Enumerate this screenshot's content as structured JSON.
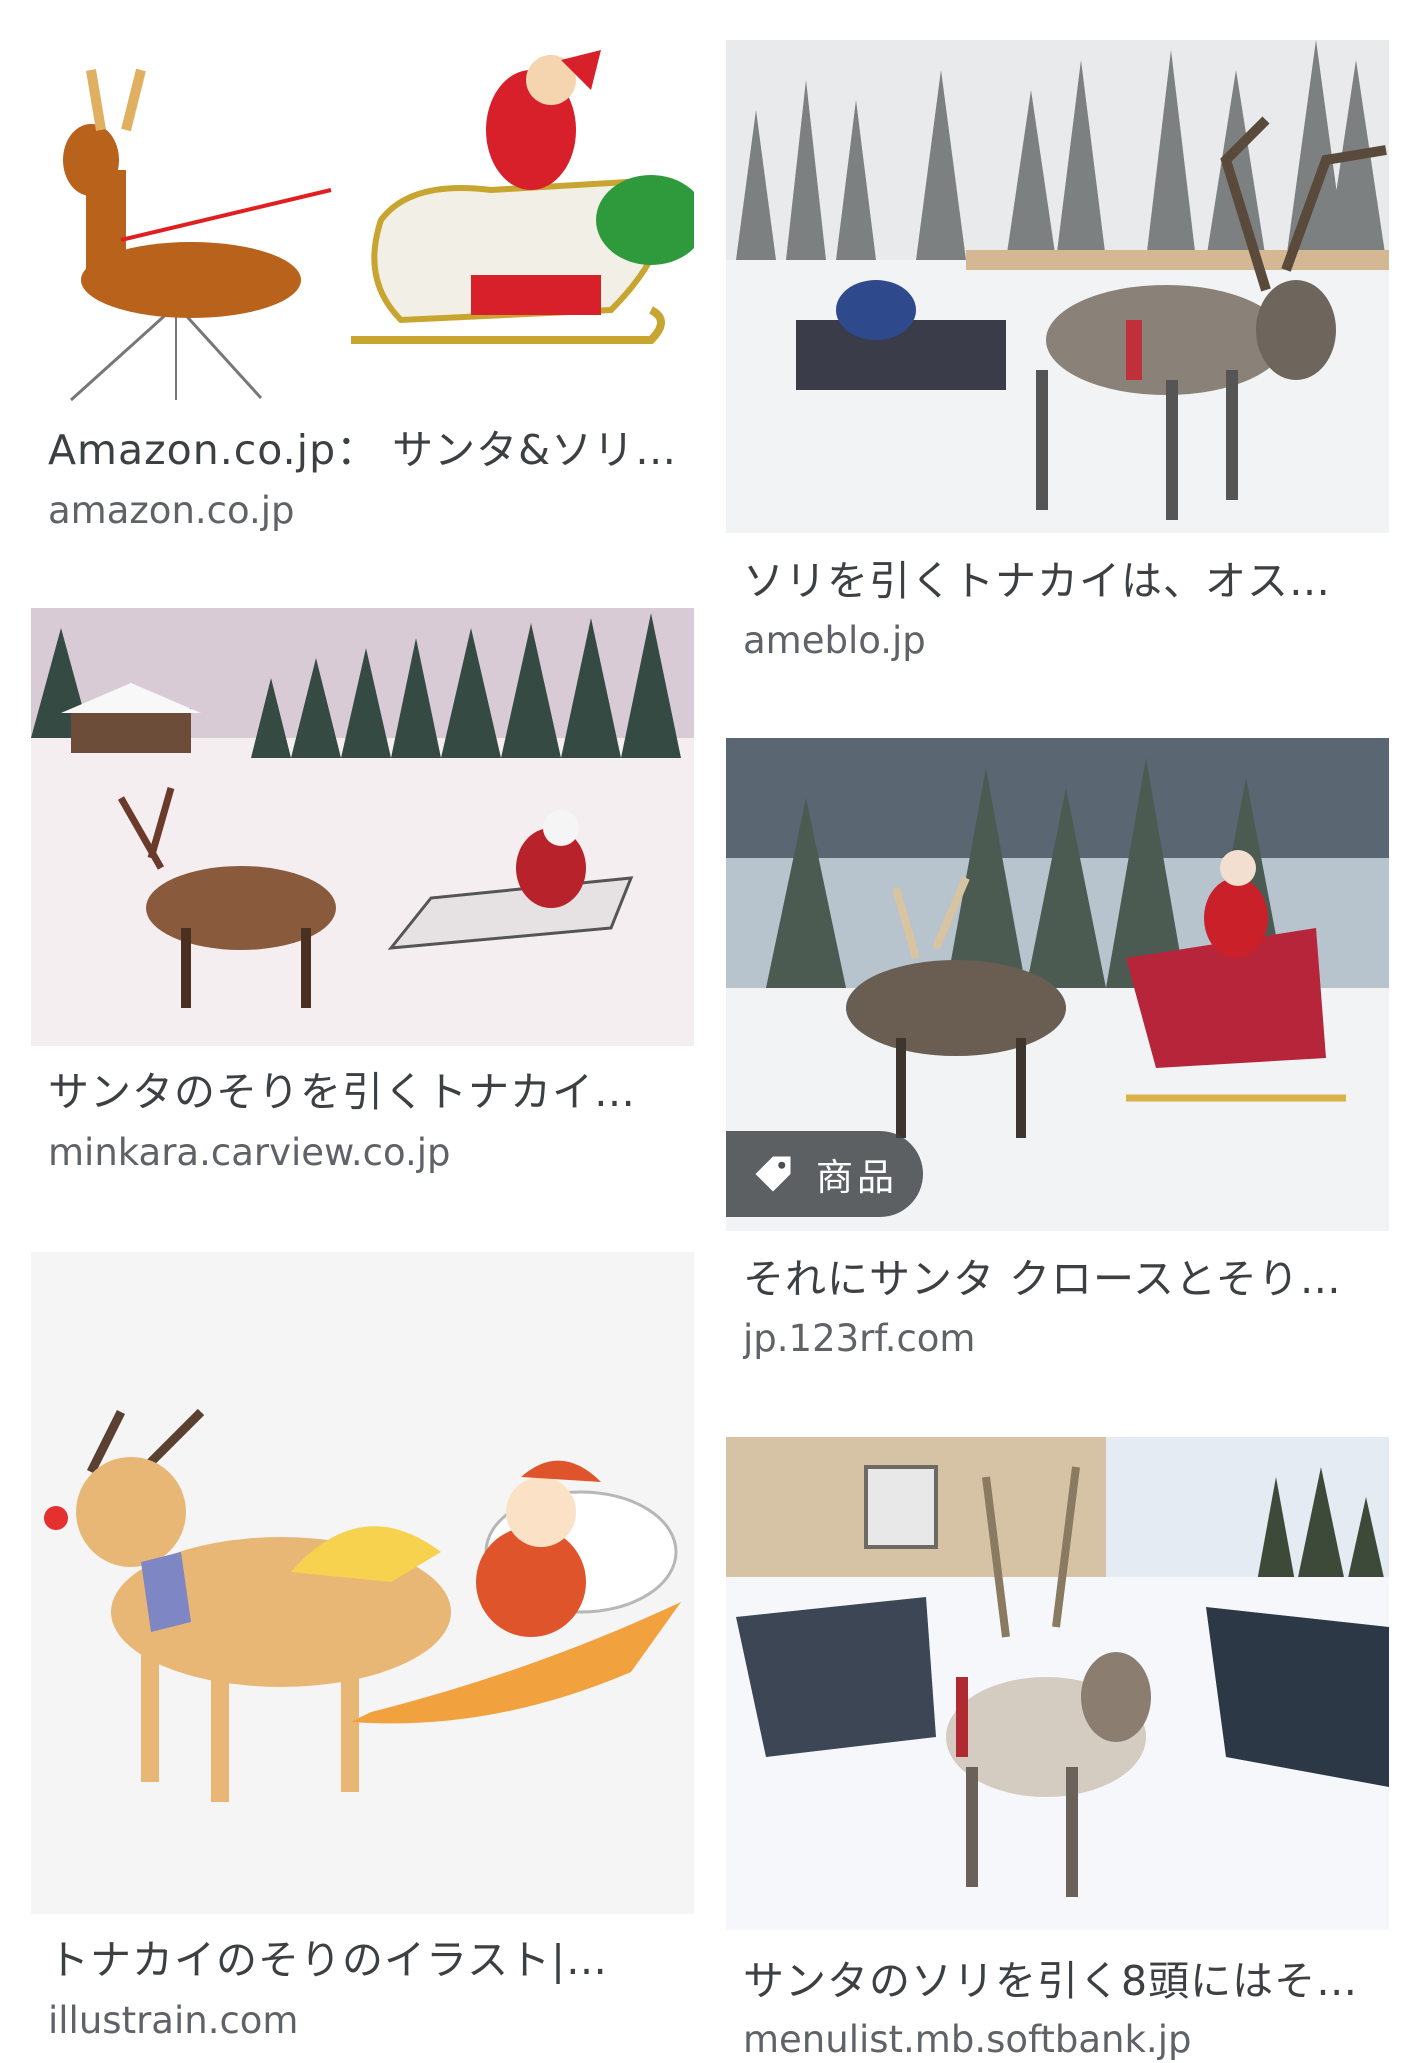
{
  "results": [
    {
      "title": "Amazon.co.jp： サンタ&ソリ…",
      "source": "amazon.co.jp"
    },
    {
      "title": "ソリを引くトナカイは、オス…",
      "source": "ameblo.jp"
    },
    {
      "title": "サンタのそりを引くトナカイ…",
      "source": "minkara.carview.co.jp"
    },
    {
      "title": "それにサンタ クロースとそり…",
      "source": "jp.123rf.com",
      "badge": "商品"
    },
    {
      "title": "トナカイのそりのイラスト|…",
      "source": "illustrain.com"
    },
    {
      "title": "サンタのソリを引く8頭にはそ…",
      "source": "menulist.mb.softbank.jp"
    }
  ],
  "colors": {
    "title": "#3c4043",
    "source": "#5f6368",
    "badge_bg": "#3c4043"
  }
}
